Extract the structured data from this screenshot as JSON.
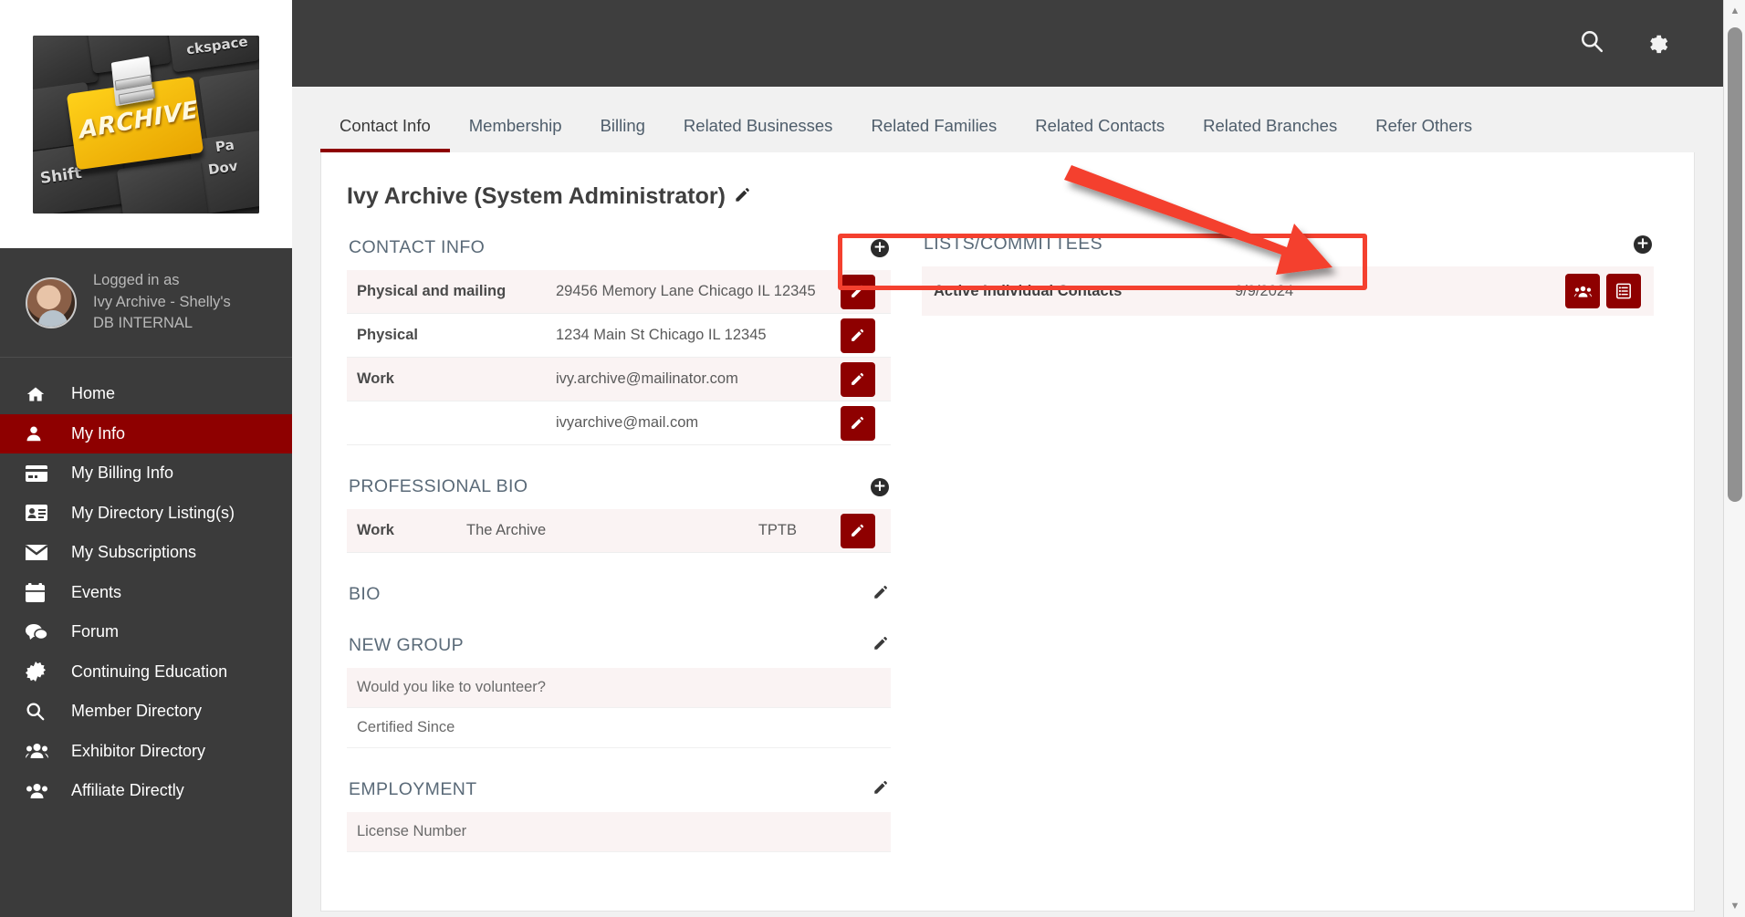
{
  "app": {
    "logo_alt": "ARCHIVE keyboard key logo",
    "logo_word": "ARCHIVE",
    "keycap_backspace": "ckspace",
    "keycap_shift": "Shift",
    "keycap_pagedown_1": "Pa",
    "keycap_pagedown_2": "Dov"
  },
  "topbar": {
    "search_icon": "search-icon",
    "settings_icon": "gear-icon"
  },
  "user": {
    "logged_in_label": "Logged in as",
    "name": "Ivy Archive - Shelly's",
    "org": "DB INTERNAL"
  },
  "sidebar": {
    "items": [
      {
        "label": "Home",
        "icon": "home-icon",
        "active": false
      },
      {
        "label": "My Info",
        "icon": "user-icon",
        "active": true
      },
      {
        "label": "My Billing Info",
        "icon": "credit-card-icon",
        "active": false
      },
      {
        "label": "My Directory Listing(s)",
        "icon": "id-card-icon",
        "active": false
      },
      {
        "label": "My Subscriptions",
        "icon": "envelope-icon",
        "active": false
      },
      {
        "label": "Events",
        "icon": "calendar-icon",
        "active": false
      },
      {
        "label": "Forum",
        "icon": "comments-icon",
        "active": false
      },
      {
        "label": "Continuing Education",
        "icon": "certificate-icon",
        "active": false
      },
      {
        "label": "Member Directory",
        "icon": "search-icon",
        "active": false
      },
      {
        "label": "Exhibitor Directory",
        "icon": "users-icon",
        "active": false
      },
      {
        "label": "Affiliate Directly",
        "icon": "users-icon",
        "active": false
      }
    ]
  },
  "tabs": [
    {
      "label": "Contact Info",
      "active": true
    },
    {
      "label": "Membership",
      "active": false
    },
    {
      "label": "Billing",
      "active": false
    },
    {
      "label": "Related Businesses",
      "active": false
    },
    {
      "label": "Related Families",
      "active": false
    },
    {
      "label": "Related Contacts",
      "active": false
    },
    {
      "label": "Related Branches",
      "active": false
    },
    {
      "label": "Refer Others",
      "active": false
    }
  ],
  "main": {
    "page_title": "Ivy Archive (System Administrator)",
    "sections": {
      "contact_info": {
        "title": "CONTACT INFO",
        "add_icon": "plus-circle-icon",
        "rows": [
          {
            "label": "Physical and mailing",
            "value": "29456 Memory Lane Chicago IL 12345",
            "edit_icon": "pencil-icon"
          },
          {
            "label": "Physical",
            "value": "1234 Main St Chicago IL 12345",
            "edit_icon": "pencil-icon"
          },
          {
            "label": "Work",
            "value": "ivy.archive@mailinator.com",
            "edit_icon": "pencil-icon"
          },
          {
            "label": "",
            "value": "ivyarchive@mail.com",
            "edit_icon": "pencil-icon"
          }
        ]
      },
      "professional_bio": {
        "title": "PROFESSIONAL BIO",
        "add_icon": "plus-circle-icon",
        "rows": [
          {
            "label": "Work",
            "value": "The Archive",
            "value2": "TPTB",
            "edit_icon": "pencil-icon"
          }
        ]
      },
      "bio": {
        "title": "BIO",
        "edit_icon": "pencil-icon"
      },
      "new_group": {
        "title": "NEW GROUP",
        "edit_icon": "pencil-icon",
        "rows": [
          {
            "label": "Would you like to volunteer?"
          },
          {
            "label": "Certified Since"
          }
        ]
      },
      "employment": {
        "title": "EMPLOYMENT",
        "edit_icon": "pencil-icon",
        "rows": [
          {
            "label": "License Number"
          }
        ]
      },
      "lists_committees": {
        "title": "LISTS/COMMITTEES",
        "add_icon": "plus-circle-icon",
        "rows": [
          {
            "name": "Active Individual Contacts",
            "date": "9/9/2024",
            "actions": [
              {
                "icon": "users-group-icon"
              },
              {
                "icon": "list-detail-icon"
              }
            ]
          }
        ]
      }
    }
  },
  "annotation": {
    "highlight_color": "#f4402f",
    "arrow_color": "#f4402f"
  },
  "scrollbar": {
    "up_arrow": "▲",
    "down_arrow": "▼"
  },
  "colors": {
    "brand_red": "#8e0000",
    "sidebar_bg": "#3b3b3b",
    "topbar_bg": "#3e3e3e",
    "row_alt_bg": "#faf3f3",
    "tab_text": "#4e5d6b"
  }
}
